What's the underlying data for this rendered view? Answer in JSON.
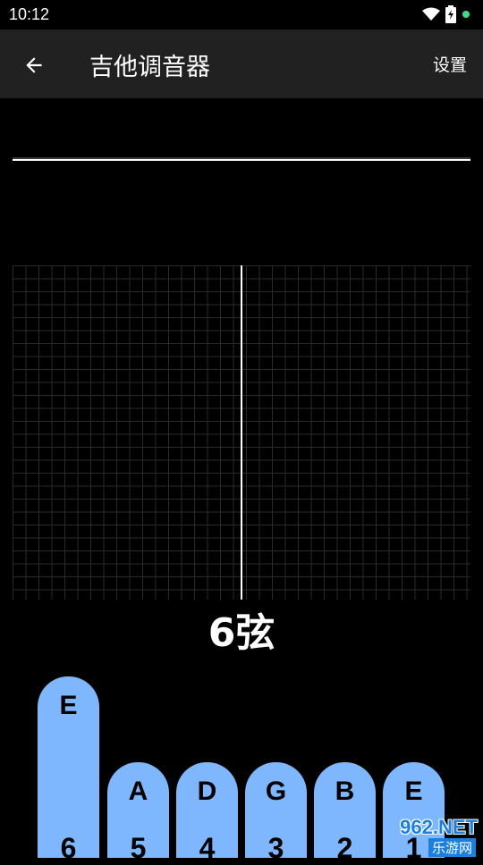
{
  "status_bar": {
    "time": "10:12",
    "icons": [
      "wifi-icon",
      "battery-charging-icon",
      "notification-dot-icon"
    ]
  },
  "app_bar": {
    "back_icon": "arrow-left-icon",
    "title": "吉他调音器",
    "settings_label": "设置"
  },
  "tuner": {
    "current_string": "6弦"
  },
  "strings": [
    {
      "note": "E",
      "number": "6",
      "selected": true
    },
    {
      "note": "A",
      "number": "5",
      "selected": false
    },
    {
      "note": "D",
      "number": "4",
      "selected": false
    },
    {
      "note": "G",
      "number": "3",
      "selected": false
    },
    {
      "note": "B",
      "number": "2",
      "selected": false
    },
    {
      "note": "E",
      "number": "1",
      "selected": false
    }
  ],
  "watermark": {
    "brand": "962.NET",
    "sub": "乐游网"
  },
  "colors": {
    "string_button": "#7fb7ff",
    "app_bar": "#212121",
    "background": "#000000",
    "status_dot": "#3ddc84"
  }
}
